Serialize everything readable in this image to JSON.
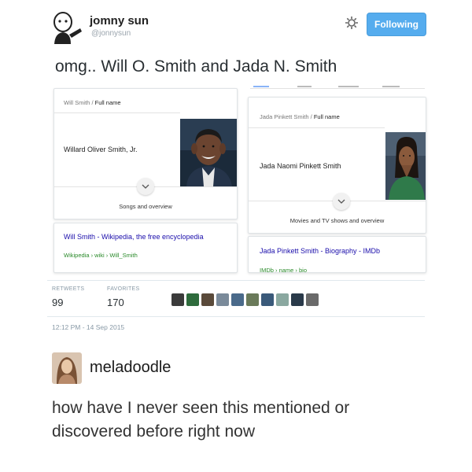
{
  "tweet": {
    "user": {
      "display_name": "jomny sun",
      "handle": "@jonnysun"
    },
    "follow_button_label": "Following",
    "text": "omg.. Will O. Smith and Jada N. Smith",
    "retweets_label": "RETWEETS",
    "retweets_count": "99",
    "favorites_label": "FAVORITES",
    "favorites_count": "170",
    "timestamp": "12:12 PM - 14 Sep 2015"
  },
  "cards": {
    "left": {
      "breadcrumb_name": "Will Smith",
      "breadcrumb_sep": "/",
      "breadcrumb_field": "Full name",
      "full_name": "Willard Oliver Smith, Jr.",
      "overview_label": "Songs and overview",
      "result_title": "Will Smith - Wikipedia, the free encyclopedia",
      "result_url": "Wikipedia › wiki › Will_Smith"
    },
    "right": {
      "breadcrumb_name": "Jada Pinkett Smith",
      "breadcrumb_sep": "/",
      "breadcrumb_field": "Full name",
      "full_name": "Jada Naomi Pinkett Smith",
      "overview_label": "Movies and TV shows and overview",
      "result_title": "Jada Pinkett Smith - Biography - IMDb",
      "result_url": "IMDb › name › bio"
    }
  },
  "reply": {
    "username": "meladoodle",
    "text": "how have I never seen this mentioned or discovered before right now"
  },
  "colors": {
    "follow_blue": "#55acee",
    "link_blue": "#1a0dab",
    "url_green": "#2a8a2a"
  }
}
